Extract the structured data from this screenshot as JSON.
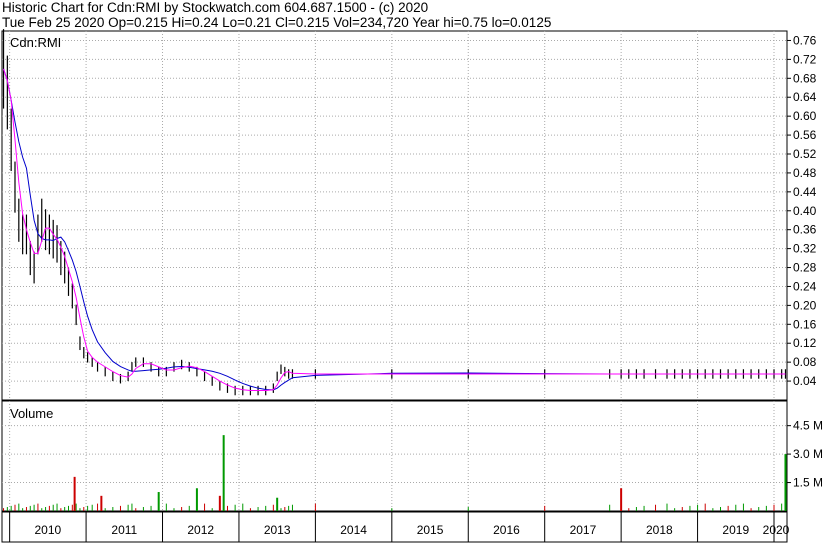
{
  "header": {
    "line1": "Historic Chart for Cdn:RMI by Stockwatch.com 604.687.1500 - (c) 2020",
    "line2": "Tue Feb 25 2020  Op=0.215  Hi=0.24  Lo=0.21  Cl=0.215  Vol=234,720  Year hi=0.75  lo=0.0125"
  },
  "chart_data": [
    {
      "type": "candlestick",
      "title": "Cdn:RMI",
      "y_ticks": [
        "0.76",
        "0.72",
        "0.68",
        "0.64",
        "0.60",
        "0.56",
        "0.52",
        "0.48",
        "0.44",
        "0.40",
        "0.36",
        "0.32",
        "0.28",
        "0.24",
        "0.20",
        "0.16",
        "0.12",
        "0.08",
        "0.04"
      ],
      "ylim": [
        0,
        0.78
      ],
      "xlim": [
        2009.9,
        2020.17
      ],
      "x_ticks": [
        "2010",
        "2011",
        "2012",
        "2013",
        "2014",
        "2015",
        "2016",
        "2017",
        "2018",
        "2019",
        "2020"
      ],
      "grid": true,
      "colors": {
        "price": "#000000",
        "ma_short": "#ff00ff",
        "ma_long": "#0000cc",
        "down_marks": "#cc0000",
        "grid": "#999999"
      },
      "series": [
        {
          "role": "close",
          "x": [
            2009.92,
            2009.97,
            2010.02,
            2010.07,
            2010.12,
            2010.17,
            2010.22,
            2010.27,
            2010.32,
            2010.37,
            2010.42,
            2010.47,
            2010.52,
            2010.57,
            2010.62,
            2010.67,
            2010.72,
            2010.77,
            2010.82,
            2010.87,
            2010.92,
            2010.97,
            2011.02,
            2011.08,
            2011.15,
            2011.25,
            2011.35,
            2011.45,
            2011.55,
            2011.6,
            2011.65,
            2011.75,
            2011.85,
            2011.95,
            2012.05,
            2012.15,
            2012.25,
            2012.35,
            2012.45,
            2012.55,
            2012.65,
            2012.75,
            2012.85,
            2012.95,
            2013.05,
            2013.15,
            2013.25,
            2013.35,
            2013.45,
            2013.5,
            2013.55,
            2013.6,
            2013.65,
            2013.7,
            2014.0,
            2015.0,
            2016.0,
            2017.0,
            2017.85,
            2018.0,
            2018.1,
            2018.2,
            2018.3,
            2018.45,
            2018.6,
            2018.7,
            2018.8,
            2018.9,
            2019.0,
            2019.1,
            2019.2,
            2019.3,
            2019.4,
            2019.5,
            2019.6,
            2019.7,
            2019.8,
            2019.9,
            2020.0,
            2020.1,
            2020.15
          ],
          "values": [
            0.7,
            0.65,
            0.55,
            0.45,
            0.38,
            0.35,
            0.35,
            0.3,
            0.28,
            0.35,
            0.38,
            0.36,
            0.35,
            0.34,
            0.33,
            0.3,
            0.28,
            0.25,
            0.22,
            0.18,
            0.12,
            0.1,
            0.09,
            0.08,
            0.07,
            0.06,
            0.05,
            0.045,
            0.05,
            0.07,
            0.08,
            0.08,
            0.07,
            0.06,
            0.06,
            0.07,
            0.075,
            0.07,
            0.06,
            0.05,
            0.04,
            0.03,
            0.025,
            0.02,
            0.02,
            0.02,
            0.02,
            0.02,
            0.025,
            0.05,
            0.065,
            0.06,
            0.055,
            0.055,
            0.055,
            0.055,
            0.055,
            0.055,
            0.055,
            0.055,
            0.055,
            0.055,
            0.055,
            0.055,
            0.055,
            0.055,
            0.055,
            0.055,
            0.055,
            0.055,
            0.055,
            0.055,
            0.055,
            0.055,
            0.055,
            0.055,
            0.055,
            0.055,
            0.055,
            0.055,
            0.055
          ]
        }
      ],
      "volume": {
        "label": "Volume",
        "y_ticks": [
          "4.5 M",
          "3.0 M",
          "1.5 M"
        ],
        "ylim": [
          0,
          5800000
        ],
        "spikes": [
          {
            "x": 2010.85,
            "value": 1800000,
            "color": "red"
          },
          {
            "x": 2011.2,
            "value": 800000,
            "color": "red"
          },
          {
            "x": 2011.95,
            "value": 1000000,
            "color": "green"
          },
          {
            "x": 2012.45,
            "value": 1200000,
            "color": "green"
          },
          {
            "x": 2012.8,
            "value": 4000000,
            "color": "green"
          },
          {
            "x": 2012.75,
            "value": 800000,
            "color": "red"
          },
          {
            "x": 2013.5,
            "value": 700000,
            "color": "green"
          },
          {
            "x": 2018.0,
            "value": 1200000,
            "color": "red"
          },
          {
            "x": 2020.15,
            "value": 3000000,
            "color": "green"
          }
        ]
      }
    }
  ]
}
